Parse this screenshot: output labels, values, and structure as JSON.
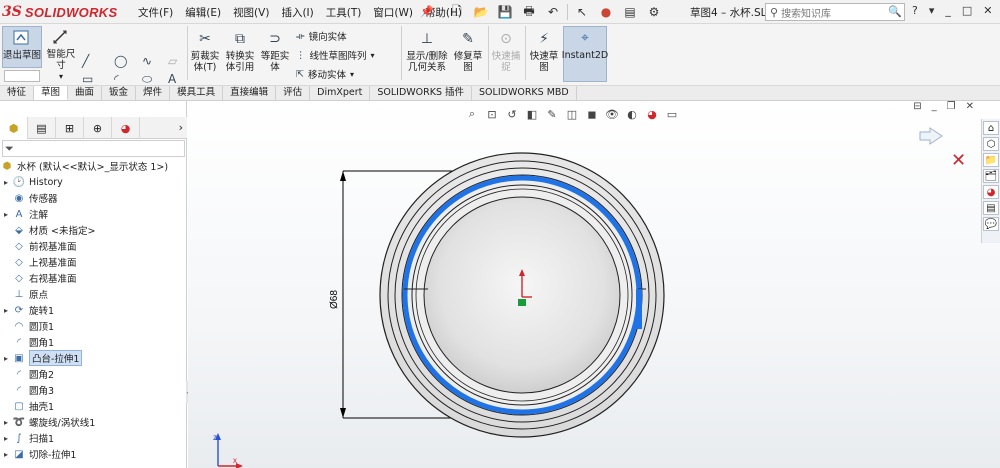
{
  "app": {
    "logo": "SOLIDWORKS",
    "logo_mark": "3S",
    "doc_title": "草图4 – 水杯.SL...",
    "brand_color": "#d0262d"
  },
  "menu": [
    "文件(F)",
    "编辑(E)",
    "视图(V)",
    "插入(I)",
    "工具(T)",
    "窗口(W)",
    "帮助(H)"
  ],
  "search": {
    "placeholder": "搜索知识库"
  },
  "window_controls": [
    "?",
    "-",
    "_",
    "□",
    "✕"
  ],
  "ribbon": {
    "exit_sketch": "退出草图",
    "smart_dim": "智能尺寸",
    "trim": "剪裁实体(T)",
    "convert": "转换实体引用",
    "offset": "等距实体",
    "mirror": "镜向实体",
    "linear_pattern": "线性草图阵列",
    "move": "移动实体",
    "display_relations": "显示/删除几何关系",
    "repair": "修复草图",
    "quick_snap": "快速捕捉",
    "rapid_sketch": "快速草图",
    "instant2d": "Instant2D"
  },
  "tabs": [
    "特征",
    "草图",
    "曲面",
    "钣金",
    "焊件",
    "模具工具",
    "直接编辑",
    "评估",
    "DimXpert",
    "SOLIDWORKS 插件",
    "SOLIDWORKS MBD"
  ],
  "selected_tab": "草图",
  "tree": {
    "root": "水杯  (默认<<默认>_显示状态 1>)",
    "items": [
      {
        "label": "History",
        "icon": "history-icon",
        "exp": "▸"
      },
      {
        "label": "传感器",
        "icon": "sensor-icon",
        "exp": ""
      },
      {
        "label": "注解",
        "icon": "annotation-icon",
        "exp": "▸"
      },
      {
        "label": "材质 <未指定>",
        "icon": "material-icon",
        "exp": ""
      },
      {
        "label": "前视基准面",
        "icon": "plane-icon",
        "exp": ""
      },
      {
        "label": "上视基准面",
        "icon": "plane-icon",
        "exp": ""
      },
      {
        "label": "右视基准面",
        "icon": "plane-icon",
        "exp": ""
      },
      {
        "label": "原点",
        "icon": "origin-icon",
        "exp": ""
      },
      {
        "label": "旋转1",
        "icon": "revolve-icon",
        "exp": "▸"
      },
      {
        "label": "圆顶1",
        "icon": "dome-icon",
        "exp": ""
      },
      {
        "label": "圆角1",
        "icon": "fillet-icon",
        "exp": ""
      },
      {
        "label": "凸台-拉伸1",
        "icon": "extrude-icon",
        "exp": "▸"
      },
      {
        "label": "圆角2",
        "icon": "fillet-icon",
        "exp": ""
      },
      {
        "label": "圆角3",
        "icon": "fillet-icon",
        "exp": ""
      },
      {
        "label": "抽壳1",
        "icon": "shell-icon",
        "exp": ""
      },
      {
        "label": "螺旋线/涡状线1",
        "icon": "helix-icon",
        "exp": "▸"
      },
      {
        "label": "扫描1",
        "icon": "sweep-icon",
        "exp": "▸"
      },
      {
        "label": "切除-拉伸1",
        "icon": "cut-icon",
        "exp": "▸"
      }
    ],
    "selected": "凸台-拉伸1"
  },
  "viewport": {
    "dimension": "Ø68"
  }
}
